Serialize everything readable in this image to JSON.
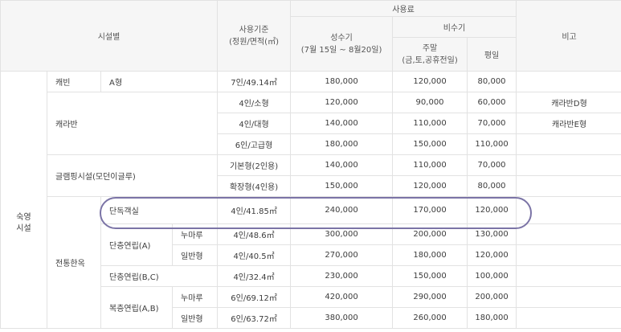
{
  "header": {
    "facility": "시설별",
    "criteria_line1": "사용기준",
    "criteria_line2": "(정원/면적(㎡)",
    "fee": "사용료",
    "remarks": "비고",
    "peak_line1": "성수기",
    "peak_line2": "(7월 15일 ~ 8월20일)",
    "offpeak": "비수기",
    "weekend_line1": "주말",
    "weekend_line2": "(금,토,공휴전일)",
    "weekday": "평일"
  },
  "categories": {
    "lodging_line1": "숙영",
    "lodging_line2": "시설",
    "cabin": "캐빈",
    "caravan": "캐라반",
    "glamping": "글램핑시설(모던이글루)",
    "hanok": "전통한옥",
    "single_floor_a": "단층연립(A)",
    "duplex_ab": "복층연립(A,B)"
  },
  "rows": [
    {
      "name": "A형",
      "criteria": "7인/49.14㎡",
      "peak": "180,000",
      "weekend": "120,000",
      "weekday": "80,000",
      "note": ""
    },
    {
      "name": "",
      "criteria": "4인/소형",
      "peak": "120,000",
      "weekend": "90,000",
      "weekday": "60,000",
      "note": "캐라반D형"
    },
    {
      "name": "",
      "criteria": "4인/대형",
      "peak": "140,000",
      "weekend": "110,000",
      "weekday": "70,000",
      "note": "캐라반E형"
    },
    {
      "name": "",
      "criteria": "6인/고급형",
      "peak": "180,000",
      "weekend": "150,000",
      "weekday": "110,000",
      "note": ""
    },
    {
      "name": "",
      "criteria": "기본형(2인용)",
      "peak": "140,000",
      "weekend": "110,000",
      "weekday": "70,000",
      "note": ""
    },
    {
      "name": "",
      "criteria": "확장형(4인용)",
      "peak": "150,000",
      "weekend": "120,000",
      "weekday": "80,000",
      "note": ""
    },
    {
      "name": "단독객실",
      "criteria": "4인/41.85㎡",
      "peak": "240,000",
      "weekend": "170,000",
      "weekday": "120,000",
      "note": ""
    },
    {
      "name": "누마루",
      "criteria": "4인/48.6㎡",
      "peak": "300,000",
      "weekend": "200,000",
      "weekday": "130,000",
      "note": ""
    },
    {
      "name": "일반형",
      "criteria": "4인/40.5㎡",
      "peak": "270,000",
      "weekend": "180,000",
      "weekday": "120,000",
      "note": ""
    },
    {
      "name": "단층연립(B,C)",
      "criteria": "4인/32.4㎡",
      "peak": "230,000",
      "weekend": "150,000",
      "weekday": "100,000",
      "note": ""
    },
    {
      "name": "누마루",
      "criteria": "6인/69.12㎡",
      "peak": "420,000",
      "weekend": "290,000",
      "weekday": "200,000",
      "note": ""
    },
    {
      "name": "일반형",
      "criteria": "6인/63.72㎡",
      "peak": "380,000",
      "weekend": "260,000",
      "weekday": "180,000",
      "note": ""
    }
  ],
  "colors": {
    "header_bg": "#f6f6f6",
    "border": "#e2e2e2",
    "highlight": "#7b74a6"
  }
}
